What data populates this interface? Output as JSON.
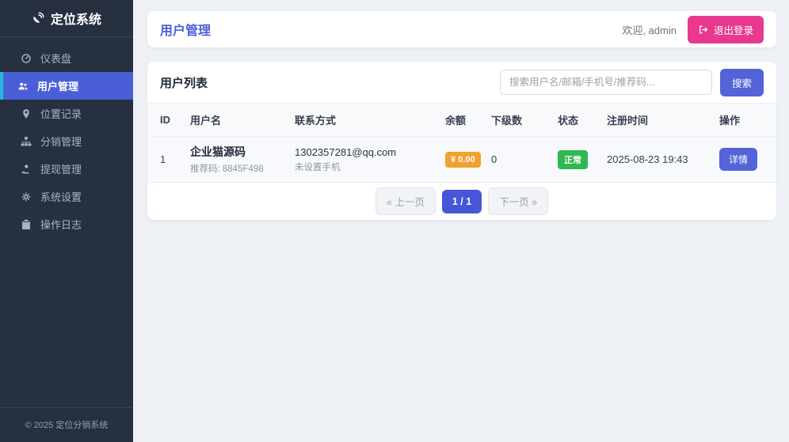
{
  "app": {
    "title": "定位系统",
    "footer": "© 2025 定位分销系统"
  },
  "sidebar": {
    "items": [
      {
        "label": "仪表盘",
        "icon": "dashboard-icon",
        "active": false
      },
      {
        "label": "用户管理",
        "icon": "users-icon",
        "active": true
      },
      {
        "label": "位置记录",
        "icon": "map-marker-icon",
        "active": false
      },
      {
        "label": "分销管理",
        "icon": "sitemap-icon",
        "active": false
      },
      {
        "label": "提现管理",
        "icon": "withdraw-icon",
        "active": false
      },
      {
        "label": "系统设置",
        "icon": "settings-icon",
        "active": false
      },
      {
        "label": "操作日志",
        "icon": "log-icon",
        "active": false
      }
    ]
  },
  "header": {
    "title": "用户管理",
    "welcome": "欢迎, admin",
    "logout_label": "退出登录",
    "logout_icon": "sign-out-icon"
  },
  "panel": {
    "title": "用户列表",
    "search_placeholder": "搜索用户名/邮箱/手机号/推荐码...",
    "search_button": "搜索"
  },
  "table": {
    "headers": [
      "ID",
      "用户名",
      "联系方式",
      "余额",
      "下级数",
      "状态",
      "注册时间",
      "操作"
    ],
    "rows": [
      {
        "id": "1",
        "username": "企业猫源码",
        "referral": "推荐码: 8845F498",
        "email": "1302357281@qq.com",
        "phone": "未设置手机",
        "balance": "¥ 0.00",
        "subordinates": "0",
        "status": "正常",
        "registered": "2025-08-23 19:43",
        "action": "详情"
      }
    ]
  },
  "pagination": {
    "prev": "« 上一页",
    "current": "1 / 1",
    "next": "下一页 »"
  },
  "colors": {
    "sidebar_bg": "#27303f",
    "active_item_blue": "#4a5fd6",
    "active_item_accent_cyan": "#25b9d8",
    "title_blue": "#4a5fd6",
    "button_blue": "#5463d8",
    "pagination_blue": "#4656d6",
    "logout_pink": "#e8398e",
    "balance_orange": "#f0a12f",
    "status_green": "#2eb84f"
  }
}
